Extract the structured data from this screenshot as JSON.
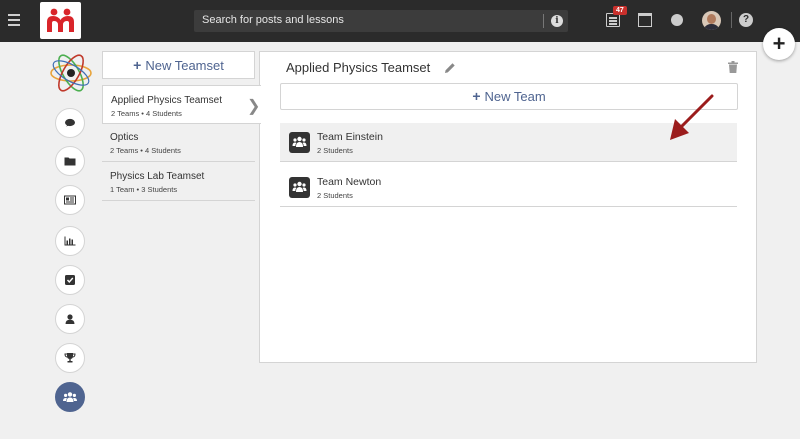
{
  "search": {
    "placeholder": "Search for posts and lessons"
  },
  "notifications": {
    "badge_count": "47"
  },
  "sidebar": {
    "new_teamset_label": "New Teamset",
    "teamsets": [
      {
        "name": "Applied Physics Teamset",
        "meta": "2 Teams • 4 Students"
      },
      {
        "name": "Optics",
        "meta": "2 Teams • 4 Students"
      },
      {
        "name": "Physics Lab Teamset",
        "meta": "1 Team • 3 Students"
      }
    ]
  },
  "main": {
    "title": "Applied Physics Teamset",
    "new_team_label": "New Team",
    "teams": [
      {
        "name": "Team Einstein",
        "meta": "2 Students"
      },
      {
        "name": "Team Newton",
        "meta": "2 Students"
      }
    ]
  },
  "icons": {
    "rail": [
      "comment-icon",
      "folder-icon",
      "newspaper-icon",
      "bar-chart-icon",
      "checkbox-icon",
      "user-icon",
      "trophy-icon",
      "group-icon"
    ]
  },
  "colors": {
    "accent": "#4f6490",
    "topbar": "#2b2b2b",
    "badge": "#c9302c",
    "arrow": "#9b1c1c",
    "logo_red": "#d9252a"
  }
}
